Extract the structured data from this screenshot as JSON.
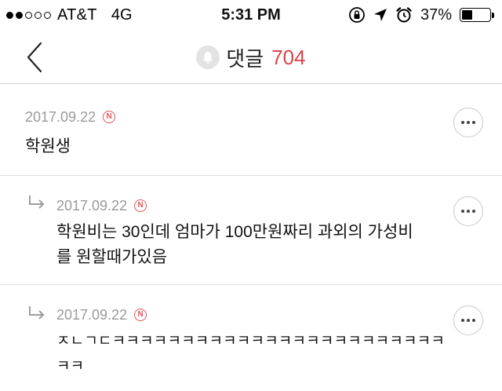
{
  "status_bar": {
    "carrier": "AT&T",
    "network": "4G",
    "time": "5:31 PM",
    "battery": "37%",
    "battery_level": 0.37,
    "signal_bars_filled": 2,
    "signal_bars_total": 5
  },
  "nav": {
    "title": "댓글",
    "count": "704",
    "count_color": "#d9434a"
  },
  "comments": [
    {
      "date": "2017.09.22",
      "badge": "N",
      "text": "학원생",
      "is_reply": false
    },
    {
      "date": "2017.09.22",
      "badge": "N",
      "text": "학원비는 30인데 엄마가 100만원짜리 과외의 가성비\n를 원할때가있음",
      "is_reply": true
    },
    {
      "date": "2017.09.22",
      "badge": "N",
      "text": "ㅈㄴㄱㄷㅋㅋㅋㅋㅋㅋㅋㅋㅋㅋㅋㅋㅋㅋㅋㅋㅋㅋㅋㅋㅋㅋㅋㅋ\nㅋㅋ",
      "is_reply": true
    }
  ],
  "icons": {
    "back": "chevron-left-icon",
    "bell": "bell-icon",
    "more": "more-icon",
    "reply": "reply-arrow-icon"
  }
}
